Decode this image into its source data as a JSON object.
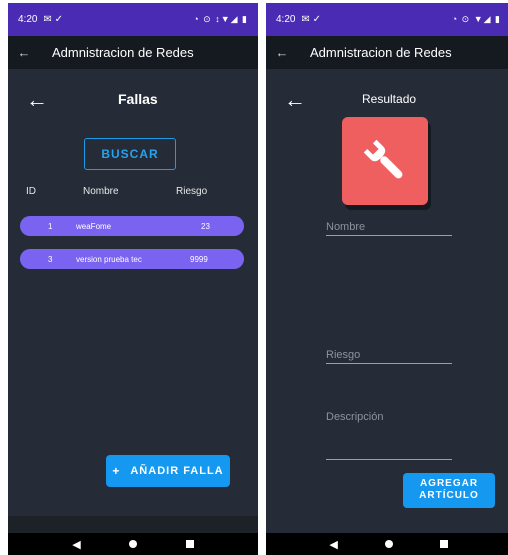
{
  "left": {
    "status": {
      "time": "4:20",
      "icons": "✉ ✓",
      "right_icons": "◔ ⊙ ↕▼◢ ▮"
    },
    "app_bar": {
      "back": "←",
      "title": "Admnistracion de Redes"
    },
    "screen": {
      "back": "←",
      "title": "Fallas",
      "search_label": "BUSCAR",
      "columns": [
        "ID",
        "Nombre",
        "Riesgo"
      ],
      "rows": [
        {
          "id": "1",
          "nombre": "weaFome",
          "riesgo": "23"
        },
        {
          "id": "3",
          "nombre": "version prueba tec",
          "riesgo": "9999"
        }
      ],
      "add_icon": "+",
      "add_label": "AÑADIR FALLA"
    },
    "nav": {
      "back": "◀"
    }
  },
  "right": {
    "status": {
      "time": "4:20",
      "icons": "✉ ✓",
      "right_icons": "◔ ⊙ ▼◢ ▮"
    },
    "app_bar": {
      "back": "←",
      "title": "Admnistracion de Redes"
    },
    "screen": {
      "back": "←",
      "title": "Resultado",
      "tile_icon": "wrench-icon",
      "fields": {
        "nombre_placeholder": "Nombre",
        "riesgo_placeholder": "Riesgo",
        "descripcion_placeholder": "Descripción"
      },
      "submit_line1": "AGREGAR",
      "submit_line2": "ARTÍCULO"
    },
    "nav": {
      "back": "◀"
    }
  },
  "colors": {
    "status_bar": "#4a2bb3",
    "app_bar": "#151a21",
    "background": "#252c37",
    "accent": "#1598f0",
    "row": "#7b63f2",
    "tile": "#f05f5f"
  }
}
